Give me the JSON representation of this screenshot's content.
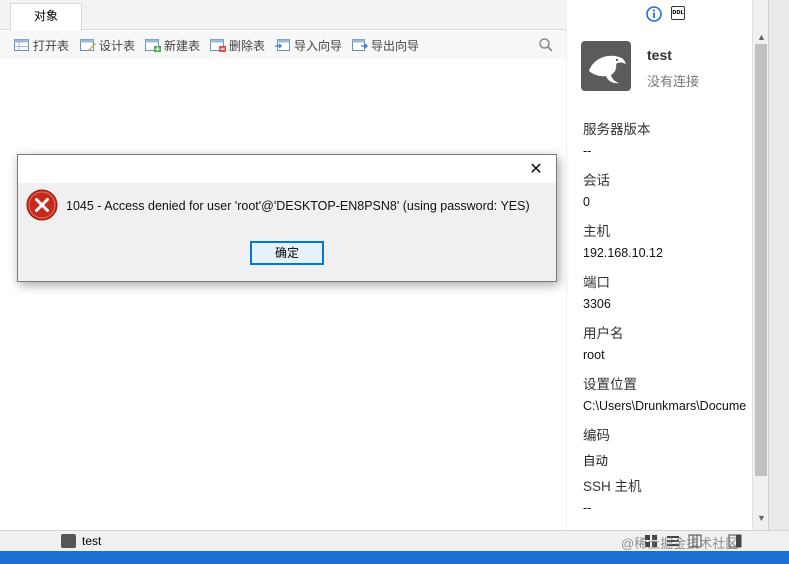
{
  "tabs": [
    {
      "label": "对象"
    }
  ],
  "toolbar": {
    "open_table": "打开表",
    "design_table": "设计表",
    "new_table": "新建表",
    "delete_table": "删除表",
    "import_wizard": "导入向导",
    "export_wizard": "导出向导"
  },
  "info_panel": {
    "connection_name": "test",
    "connection_status": "没有连接",
    "fields": [
      {
        "label": "服务器版本",
        "value": "--"
      },
      {
        "label": "会话",
        "value": "0"
      },
      {
        "label": "主机",
        "value": "192.168.10.12"
      },
      {
        "label": "端口",
        "value": "3306"
      },
      {
        "label": "用户名",
        "value": "root"
      },
      {
        "label": "设置位置",
        "value": "C:\\Users\\Drunkmars\\Docume"
      },
      {
        "label": "编码",
        "value": "自动"
      },
      {
        "label": "SSH 主机",
        "value": "--"
      }
    ]
  },
  "statusbar": {
    "connection": "test",
    "watermark": "@稀土掘金技术社区"
  },
  "dialog": {
    "close_glyph": "✕",
    "message": "1045 - Access denied for user 'root'@'DESKTOP-EN8PSN8' (using password: YES)",
    "ok_label": "确定"
  },
  "colors": {
    "accent": "#0078d7",
    "error": "#c42b1c",
    "info": "#1e6fd9",
    "taskbar": "#1c70d4"
  },
  "icons": [
    "search-icon",
    "info-icon",
    "ddl-icon",
    "error-icon",
    "close-icon"
  ]
}
